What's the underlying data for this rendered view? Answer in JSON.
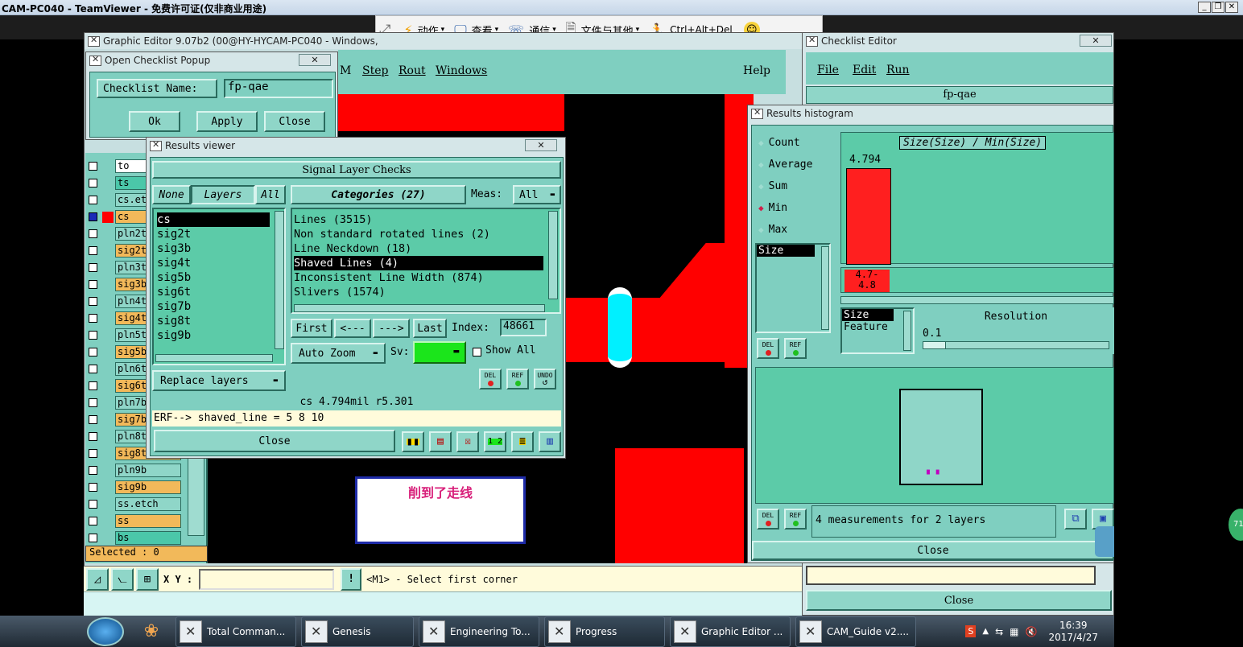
{
  "teamviewer": {
    "title": "CAM-PC040 - TeamViewer - 免费许可证(仅非商业用途)",
    "toolbar": [
      {
        "label": "动作",
        "icon": "lightning-icon"
      },
      {
        "label": "查看",
        "icon": "monitor-icon"
      },
      {
        "label": "通信",
        "icon": "phone-icon"
      },
      {
        "label": "文件与其他",
        "icon": "file-transfer-icon"
      },
      {
        "label": "Ctrl+Alt+Del",
        "icon": "run-icon"
      }
    ]
  },
  "graphic_editor": {
    "title": "Graphic Editor 9.07b2 (00@HY-HYCAM-PC040 - Windows,",
    "menu_partial": "M",
    "menu": [
      "Step",
      "Rout",
      "Windows"
    ],
    "help": "Help",
    "layers": [
      {
        "name": "to",
        "color": "#ffffff",
        "state": "off"
      },
      {
        "name": "ts",
        "color": "#4bc7a9",
        "state": "off"
      },
      {
        "name": "cs.et",
        "color": "#8fd6c8",
        "state": "off"
      },
      {
        "name": "cs",
        "color": "#f2b95a",
        "state": "on"
      },
      {
        "name": "pln2t",
        "color": "#8fd6c8",
        "state": "off"
      },
      {
        "name": "sig2t",
        "color": "#f2b95a",
        "state": "off"
      },
      {
        "name": "pln3t",
        "color": "#8fd6c8",
        "state": "off"
      },
      {
        "name": "sig3b",
        "color": "#f2b95a",
        "state": "off"
      },
      {
        "name": "pln4t",
        "color": "#8fd6c8",
        "state": "off"
      },
      {
        "name": "sig4t",
        "color": "#f2b95a",
        "state": "off"
      },
      {
        "name": "pln5t",
        "color": "#8fd6c8",
        "state": "off"
      },
      {
        "name": "sig5b",
        "color": "#f2b95a",
        "state": "off"
      },
      {
        "name": "pln6t",
        "color": "#8fd6c8",
        "state": "off"
      },
      {
        "name": "sig6t",
        "color": "#f2b95a",
        "state": "off"
      },
      {
        "name": "pln7b",
        "color": "#8fd6c8",
        "state": "off"
      },
      {
        "name": "sig7b",
        "color": "#f2b95a",
        "state": "off"
      },
      {
        "name": "pln8t",
        "color": "#8fd6c8",
        "state": "off"
      },
      {
        "name": "sig8t",
        "color": "#f2b95a",
        "state": "off"
      },
      {
        "name": "pln9b",
        "color": "#8fd6c8",
        "state": "off"
      },
      {
        "name": "sig9b",
        "color": "#f2b95a",
        "state": "off"
      },
      {
        "name": "ss.etch",
        "color": "#8fd6c8",
        "state": "off"
      },
      {
        "name": "ss",
        "color": "#f2b95a",
        "state": "off"
      },
      {
        "name": "bs",
        "color": "#4bc7a9",
        "state": "off"
      }
    ],
    "selected": "Selected : 0",
    "xy_label": "X Y :",
    "xy_value": "",
    "status_msg": "<M1> - Select first corner",
    "annotation": "削到了走线"
  },
  "checklist_popup": {
    "title": "Open Checklist Popup",
    "name_label": "Checklist Name:",
    "name_value": "fp-qae",
    "ok": "Ok",
    "apply": "Apply",
    "close": "Close",
    "close_x": "✕"
  },
  "results_viewer": {
    "title": "Results viewer",
    "header": "Signal Layer Checks",
    "none": "None",
    "layers": "Layers",
    "all": "All",
    "categories": "Categories (27)",
    "meas_label": "Meas:",
    "meas_value": "All",
    "layer_list": [
      "cs",
      "sig2t",
      "sig3b",
      "sig4t",
      "sig5b",
      "sig6t",
      "sig7b",
      "sig8t",
      "sig9b"
    ],
    "category_list": [
      "Lines (3515)",
      "Non standard rotated lines (2)",
      "Line Neckdown (18)",
      "Shaved Lines (4)",
      "Inconsistent Line Width (874)",
      "Slivers (1574)"
    ],
    "selected_category": "Shaved Lines (4)",
    "first": "First",
    "prev": "<---",
    "next": "--->",
    "last": "Last",
    "index_label": "Index:",
    "index_value": "48661",
    "auto_zoom": "Auto Zoom",
    "sv_label": "Sv:",
    "show_all": "Show All",
    "replace_layers": "Replace layers",
    "status": "cs 4.794mil  r5.301",
    "erf": "ERF--> shaved_line = 5 8 10",
    "close": "Close",
    "del": "DEL",
    "ref": "REF",
    "undo": "UNDO"
  },
  "checklist_editor": {
    "title": "Checklist Editor",
    "menu": [
      "File",
      "Edit",
      "Run"
    ],
    "name": "fp-qae",
    "close": "Close"
  },
  "histogram": {
    "title": "Results histogram",
    "options": [
      "Count",
      "Average",
      "Sum",
      "Min",
      "Max"
    ],
    "selected_option": "Min",
    "chart_title": "Size(Size) / Min(Size)",
    "bar_value": "4.794",
    "bar_range": "4.7-\n4.8",
    "list_item": "Size",
    "size_items": [
      "Size",
      "Feature"
    ],
    "resolution_label": "Resolution",
    "resolution_value": "0.1",
    "summary": "4 measurements for 2 layers",
    "close": "Close",
    "del": "DEL",
    "ref": "REF"
  },
  "taskbar": {
    "items": [
      "Total Comman...",
      "Genesis",
      "Engineering To...",
      "Progress",
      "Graphic Editor ...",
      "CAM_Guide v2...."
    ],
    "time": "16:39",
    "date": "2017/4/27",
    "badge": "71"
  }
}
